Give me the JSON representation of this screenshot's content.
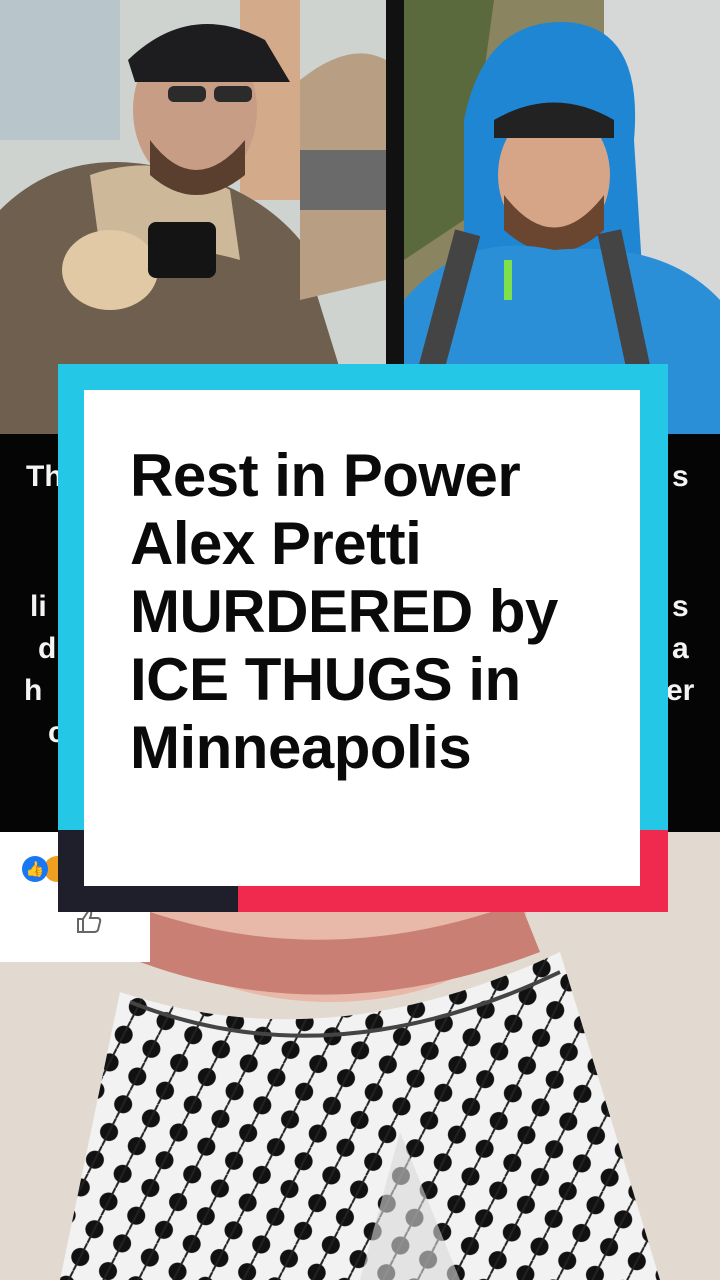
{
  "card": {
    "lines": [
      "Rest in Power",
      "Alex Pretti",
      "MURDERED by",
      "ICE THUGS in",
      "Minneapolis"
    ]
  },
  "caption_fragments": {
    "left": [
      "Th",
      "li",
      "d",
      "h",
      "c"
    ],
    "right": [
      "s",
      "s",
      "a",
      "er"
    ]
  },
  "colors": {
    "frame_cyan": "#25c7e6",
    "frame_red": "#f0294f",
    "frame_dark": "#1f1f2b",
    "card_bg": "#ffffff",
    "text": "#0a0a0a"
  },
  "icons": {
    "like": "thumbs-up-icon",
    "reaction": "love-reaction-icon"
  }
}
